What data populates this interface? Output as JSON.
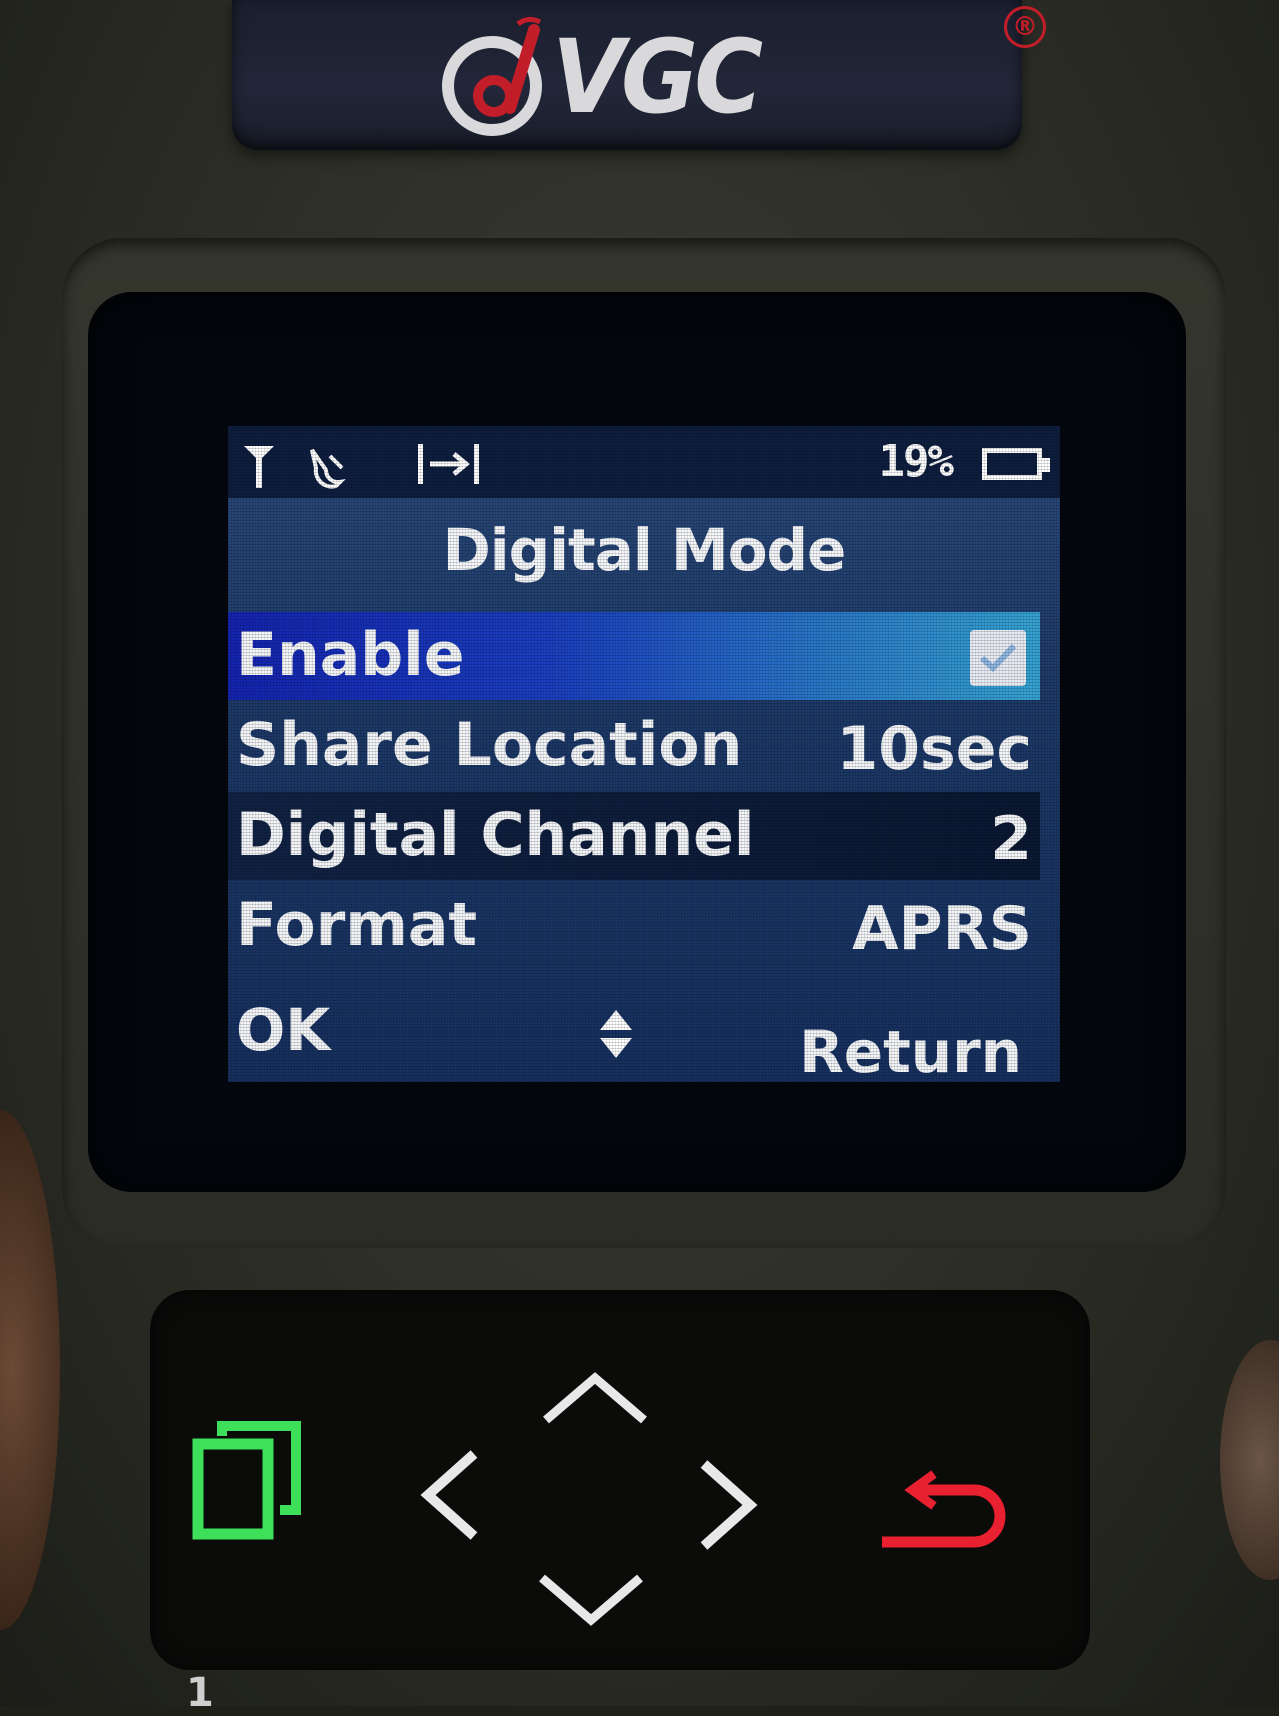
{
  "brand": {
    "logo_text": "VGC",
    "registered_mark": "®"
  },
  "status_bar": {
    "icons": [
      "antenna-icon",
      "gps-off-icon",
      "scan-icon"
    ],
    "battery_percent": "19%",
    "battery_icon": "battery-icon"
  },
  "screen": {
    "title": "Digital Mode",
    "menu_items": [
      {
        "label": "Enable",
        "value": "",
        "checked": true,
        "selected": true
      },
      {
        "label": "Share Location",
        "value": "10sec"
      },
      {
        "label": "Digital Channel",
        "value": "2"
      },
      {
        "label": "Format",
        "value": "APRS"
      }
    ],
    "softkeys": {
      "left": "OK",
      "center_icon": "up-down-icon",
      "right": "Return"
    }
  },
  "keypad": {
    "keys": [
      "menu-key-icon",
      "up-arrow-icon",
      "left-arrow-icon",
      "right-arrow-icon",
      "down-arrow-icon",
      "back-key-icon"
    ],
    "colors": {
      "menu_key": "#3ee05a",
      "back_key": "#e8202f",
      "nav_keys": "#e8e8e8"
    }
  },
  "bottom_key_label": "1"
}
